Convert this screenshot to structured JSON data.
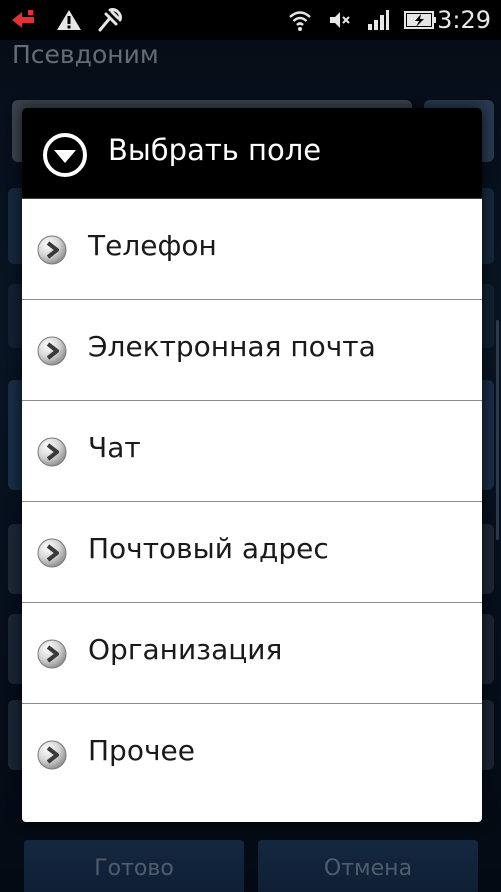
{
  "status_bar": {
    "time": "3:29",
    "icons": [
      "usb-notification-icon",
      "warning-icon",
      "debug-icon",
      "wifi-icon",
      "mute-icon",
      "signal-icon",
      "battery-charging-icon"
    ]
  },
  "background_form": {
    "label": "Псевдоним",
    "done_button": "Готово",
    "cancel_button": "Отмена"
  },
  "dialog": {
    "title": "Выбрать поле",
    "header_icon": "chevron-down-circle-icon",
    "items": [
      {
        "label": "Телефон",
        "icon": "chevron-right-icon"
      },
      {
        "label": "Электронная почта",
        "icon": "chevron-right-icon"
      },
      {
        "label": "Чат",
        "icon": "chevron-right-icon"
      },
      {
        "label": "Почтовый адрес",
        "icon": "chevron-right-icon"
      },
      {
        "label": "Организация",
        "icon": "chevron-right-icon"
      },
      {
        "label": "Прочее",
        "icon": "chevron-right-icon"
      }
    ]
  },
  "colors": {
    "dialog_bg": "#ffffff",
    "header_bg": "#000000",
    "item_text": "#1a1a1a",
    "divider": "#8c8c8c",
    "background_accent": "#1f3d63"
  }
}
